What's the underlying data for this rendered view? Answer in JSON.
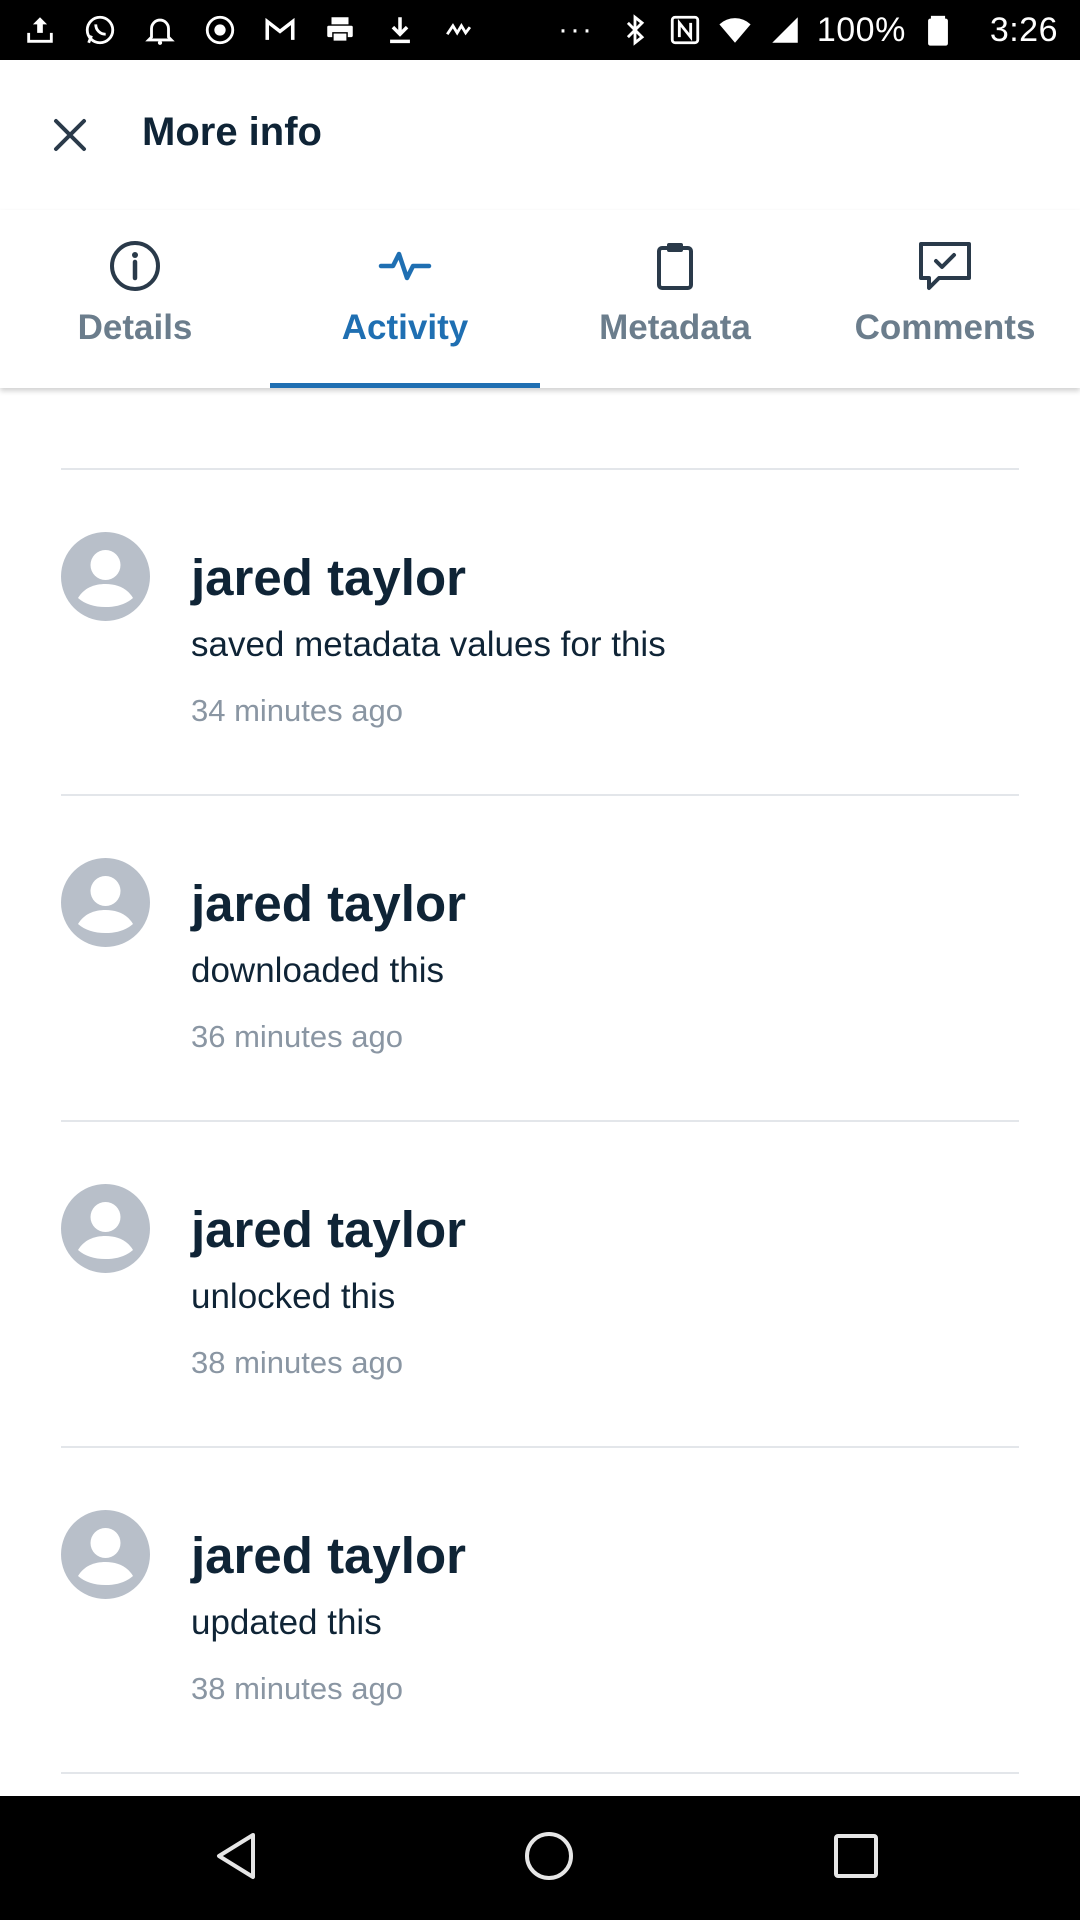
{
  "status_bar": {
    "battery_percent": "100%",
    "time": "3:26",
    "overflow": "···",
    "icons": [
      "upload-icon",
      "whatsapp-icon",
      "bell-icon",
      "record-icon",
      "gmail-icon",
      "print-icon",
      "download-icon",
      "app-icon",
      "bluetooth-icon",
      "nfc-icon",
      "wifi-icon",
      "signal-icon",
      "battery-icon"
    ]
  },
  "header": {
    "title": "More info",
    "close_icon": "close-icon"
  },
  "tabs": [
    {
      "label": "Details",
      "icon": "info-icon",
      "active": false
    },
    {
      "label": "Activity",
      "icon": "activity-icon",
      "active": true
    },
    {
      "label": "Metadata",
      "icon": "clipboard-icon",
      "active": false
    },
    {
      "label": "Comments",
      "icon": "comment-check-icon",
      "active": false
    }
  ],
  "activity": [
    {
      "user": "jared taylor",
      "action": "saved metadata values for this",
      "time": "34 minutes ago"
    },
    {
      "user": "jared taylor",
      "action": "downloaded this",
      "time": "36 minutes ago"
    },
    {
      "user": "jared taylor",
      "action": "unlocked this",
      "time": "38 minutes ago"
    },
    {
      "user": "jared taylor",
      "action": "updated this",
      "time": "38 minutes ago"
    }
  ],
  "colors": {
    "accent": "#1f6fb2",
    "text_dark": "#0f2436",
    "text_muted": "#8a96a3",
    "tab_inactive": "#6b7d8c",
    "avatar": "#b8bfc9"
  },
  "nav_bar": {
    "buttons": [
      "back-icon",
      "home-icon",
      "recents-icon"
    ]
  }
}
